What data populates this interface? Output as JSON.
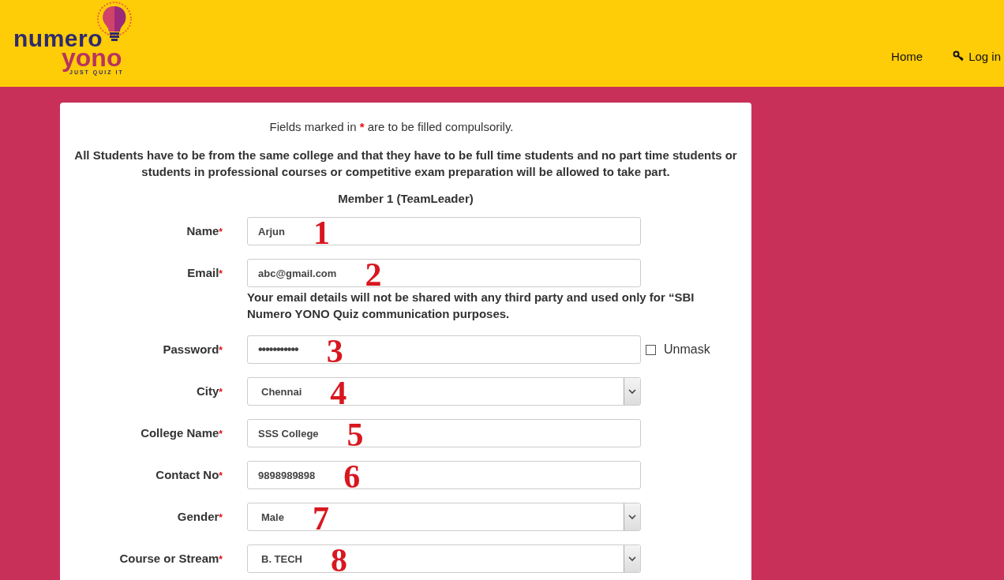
{
  "header": {
    "logo": {
      "word_1": "numero",
      "word_2": "yono",
      "tagline": "JUST QUIZ IT"
    },
    "nav": [
      {
        "label": "Home",
        "kind": "plain"
      },
      {
        "label": "Log in",
        "kind": "login"
      }
    ]
  },
  "form": {
    "intro": {
      "before": "Fields marked in ",
      "mark": "*",
      "after": " are to be filled compulsorily."
    },
    "notice": "All Students have to be from the same college and that they have to be full time students and no part time students or students in professional courses or competitive exam preparation will be allowed to take part.",
    "section_title": "Member 1 (TeamLeader)",
    "fields": [
      {
        "label": "Name",
        "required_mark": "*",
        "kind": "text",
        "value": "Arjun",
        "annotation": "1"
      },
      {
        "label": "Email",
        "required_mark": "*",
        "kind": "text",
        "value": "abc@gmail.com",
        "annotation": "2",
        "note": "Your email details will not be shared with any third party and used only for “SBI Numero YONO Quiz communication purposes."
      },
      {
        "label": "Password",
        "required_mark": "*",
        "kind": "password",
        "value": "•••••••••••",
        "annotation": "3",
        "toggle": {
          "label": "Unmask",
          "checked": false
        }
      },
      {
        "label": "City",
        "required_mark": "*",
        "kind": "select",
        "value": "Chennai",
        "annotation": "4"
      },
      {
        "label": "College Name",
        "required_mark": "*",
        "kind": "text",
        "value": "SSS College",
        "annotation": "5"
      },
      {
        "label": "Contact No",
        "required_mark": "*",
        "kind": "text",
        "value": "9898989898",
        "annotation": "6"
      },
      {
        "label": "Gender",
        "required_mark": "*",
        "kind": "select",
        "value": "Male",
        "annotation": "7"
      },
      {
        "label": "Course or Stream",
        "required_mark": "*",
        "kind": "select",
        "value": "B. TECH",
        "annotation": "8"
      }
    ]
  }
}
